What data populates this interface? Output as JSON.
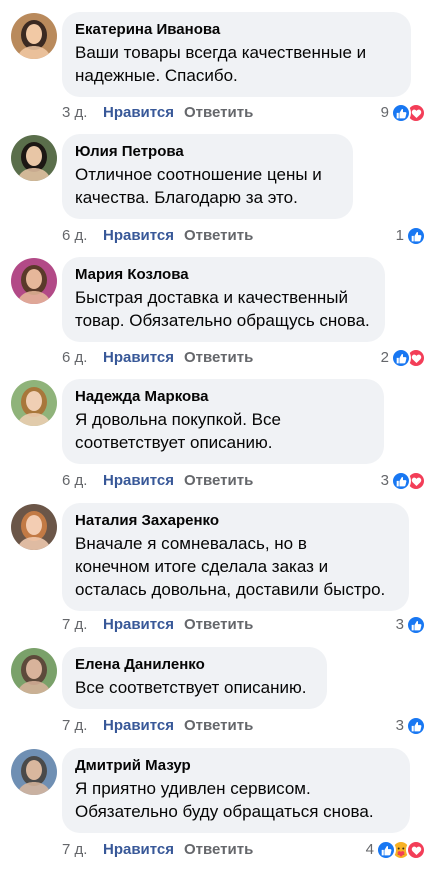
{
  "comments": [
    {
      "author": "Екатерина Иванова",
      "text_lines": [
        "Ваши товары всегда качественные и",
        "надежные. Спасибо."
      ],
      "time": "3 д.",
      "like_label": "Нравится",
      "reply_label": "Ответить",
      "reaction_count": "9",
      "reactions": [
        "like-icon",
        "love-icon"
      ]
    },
    {
      "author": "Юлия Петрова",
      "text_lines": [
        "Отличное соотношение цены и",
        "качества. Благодарю за это."
      ],
      "time": "6 д.",
      "like_label": "Нравится",
      "reply_label": "Ответить",
      "reaction_count": "1",
      "reactions": [
        "like-icon"
      ]
    },
    {
      "author": "Мария Козлова",
      "text_lines": [
        "Быстрая доставка и качественный",
        "товар. Обязательно обращусь снова."
      ],
      "time": "6 д.",
      "like_label": "Нравится",
      "reply_label": "Ответить",
      "reaction_count": "2",
      "reactions": [
        "like-icon",
        "love-icon"
      ]
    },
    {
      "author": "Надежда Маркова",
      "text_lines": [
        "Я довольна покупкой. Все",
        "соответствует описанию."
      ],
      "time": "6 д.",
      "like_label": "Нравится",
      "reply_label": "Ответить",
      "reaction_count": "3",
      "reactions": [
        "like-icon",
        "love-icon"
      ]
    },
    {
      "author": "Наталия Захаренко",
      "text_lines": [
        "Вначале я сомневалась, но в",
        "конечном итоге сделала заказ и",
        "осталась довольна, доставили быстро."
      ],
      "time": "7 д.",
      "like_label": "Нравится",
      "reply_label": "Ответить",
      "reaction_count": "3",
      "reactions": [
        "like-icon"
      ]
    },
    {
      "author": "Елена Даниленко",
      "text_lines": [
        "Все соответствует описанию."
      ],
      "time": "7 д.",
      "like_label": "Нравится",
      "reply_label": "Ответить",
      "reaction_count": "3",
      "reactions": [
        "like-icon"
      ]
    },
    {
      "author": "Дмитрий Мазур",
      "text_lines": [
        "Я приятно удивлен сервисом.",
        "Обязательно буду обращаться снова."
      ],
      "time": "7 д.",
      "like_label": "Нравится",
      "reply_label": "Ответить",
      "reaction_count": "4",
      "reactions": [
        "like-icon",
        "care-icon",
        "love-icon"
      ]
    }
  ],
  "colors": {
    "bubble": "#f0f2f5",
    "like_link": "#385898",
    "muted": "#65676b",
    "like_reaction": "#1877f2",
    "love_reaction": "#f33e58",
    "care_reaction": "#f7b125"
  }
}
